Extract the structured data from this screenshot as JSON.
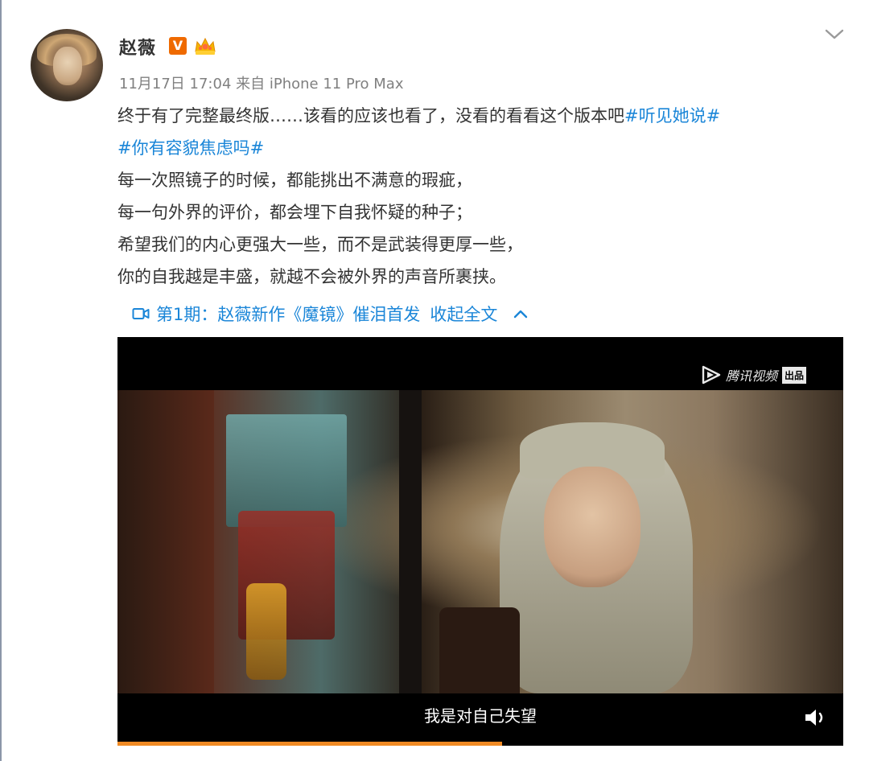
{
  "user": {
    "name": "赵薇",
    "verified_badge": "V",
    "badge_icons": [
      "verified-v-icon",
      "crown-member-icon"
    ],
    "badge_color": "#ef6a00"
  },
  "meta": {
    "date": "11月17日 17:04",
    "source_prefix": "来自",
    "source_device": "iPhone 11 Pro Max"
  },
  "post": {
    "text_plain": "终于有了完整最终版……该看的应该也看了，没看的看看这个版本吧",
    "hashtag1": "#听见她说#",
    "hashtag2": "#你有容貌焦虑吗#",
    "hashtag_color": "#1b86d8",
    "lines": [
      "每一次照镜子的时候，都能挑出不满意的瑕疵，",
      "每一句外界的评价，都会埋下自我怀疑的种子；",
      "希望我们的内心更强大一些，而不是武装得更厚一些，",
      "你的自我越是丰盛，就越不会被外界的声音所裹挟。"
    ],
    "video_link_text": "第1期：赵薇新作《魔镜》催泪首发",
    "collapse_text": "收起全文"
  },
  "video": {
    "logo_text": "腾讯视频",
    "logo_badge": "出品",
    "subtitle": "我是对自己失望",
    "progress": 0.53,
    "progress_color": "#f08a24"
  }
}
